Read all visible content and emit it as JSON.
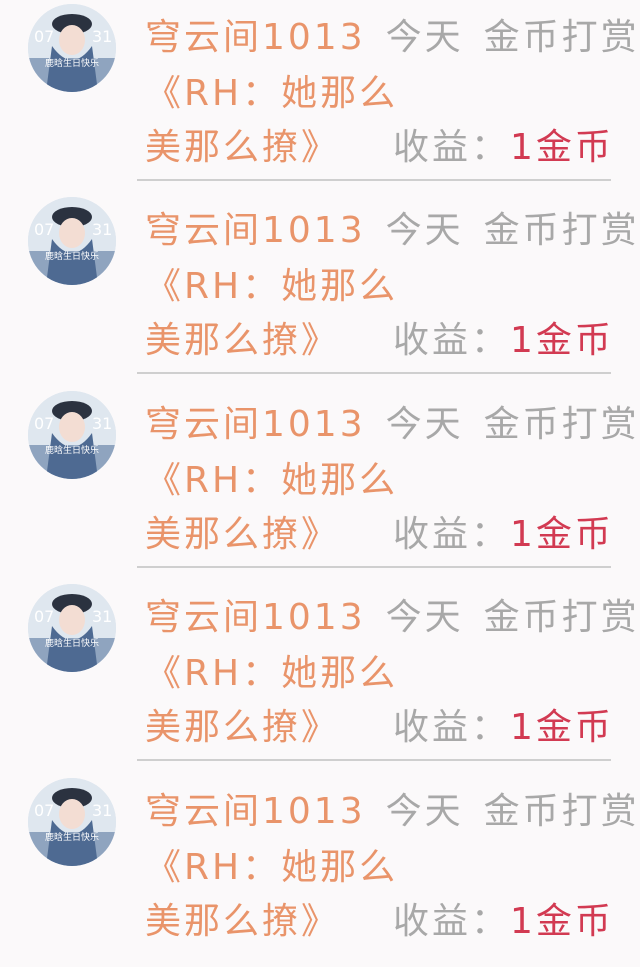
{
  "items": [
    {
      "sender": "穹云间1013",
      "time": "今天",
      "action": "金币打赏",
      "title_line1": "《RH：她那么",
      "title_line2": "美那么撩》",
      "income_label": "收益：",
      "income_value": "1金币",
      "avatar_text_top": "07",
      "avatar_text_right": "31",
      "avatar_caption": "鹿晗生日快乐"
    },
    {
      "sender": "穹云间1013",
      "time": "今天",
      "action": "金币打赏",
      "title_line1": "《RH：她那么",
      "title_line2": "美那么撩》",
      "income_label": "收益：",
      "income_value": "1金币",
      "avatar_text_top": "07",
      "avatar_text_right": "31",
      "avatar_caption": "鹿晗生日快乐"
    },
    {
      "sender": "穹云间1013",
      "time": "今天",
      "action": "金币打赏",
      "title_line1": "《RH：她那么",
      "title_line2": "美那么撩》",
      "income_label": "收益：",
      "income_value": "1金币",
      "avatar_text_top": "07",
      "avatar_text_right": "31",
      "avatar_caption": "鹿晗生日快乐"
    },
    {
      "sender": "穹云间1013",
      "time": "今天",
      "action": "金币打赏",
      "title_line1": "《RH：她那么",
      "title_line2": "美那么撩》",
      "income_label": "收益：",
      "income_value": "1金币",
      "avatar_text_top": "07",
      "avatar_text_right": "31",
      "avatar_caption": "鹿晗生日快乐"
    },
    {
      "sender": "穹云间1013",
      "time": "今天",
      "action": "金币打赏",
      "title_line1": "《RH：她那么",
      "title_line2": "美那么撩》",
      "income_label": "收益：",
      "income_value": "1金币",
      "avatar_text_top": "07",
      "avatar_text_right": "31",
      "avatar_caption": "鹿晗生日快乐"
    }
  ],
  "colors": {
    "orange": "#e9946a",
    "gray": "#a8a8a8",
    "red": "#d23a52",
    "background": "#fbf9fa"
  }
}
